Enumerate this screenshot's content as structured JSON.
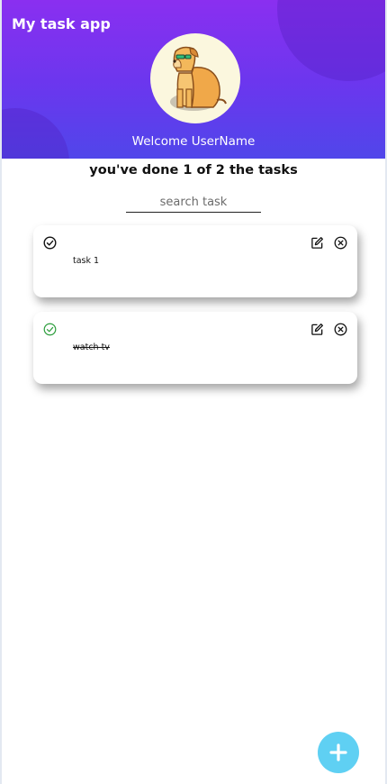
{
  "header": {
    "title": "My task app",
    "welcome": "Welcome UserName",
    "avatar_icon": "dog-avatar-icon"
  },
  "summary": "you've done 1 of 2 the tasks",
  "search": {
    "placeholder": "search task",
    "value": ""
  },
  "tasks": [
    {
      "text": "task 1",
      "done": false
    },
    {
      "text": "watch tv",
      "done": true
    }
  ],
  "colors": {
    "header_top": "#8a2ff0",
    "header_bottom": "#5046ea",
    "done_check": "#2e9e3e",
    "fab": "#5fd0f3"
  },
  "fab": {
    "icon": "plus-icon"
  }
}
